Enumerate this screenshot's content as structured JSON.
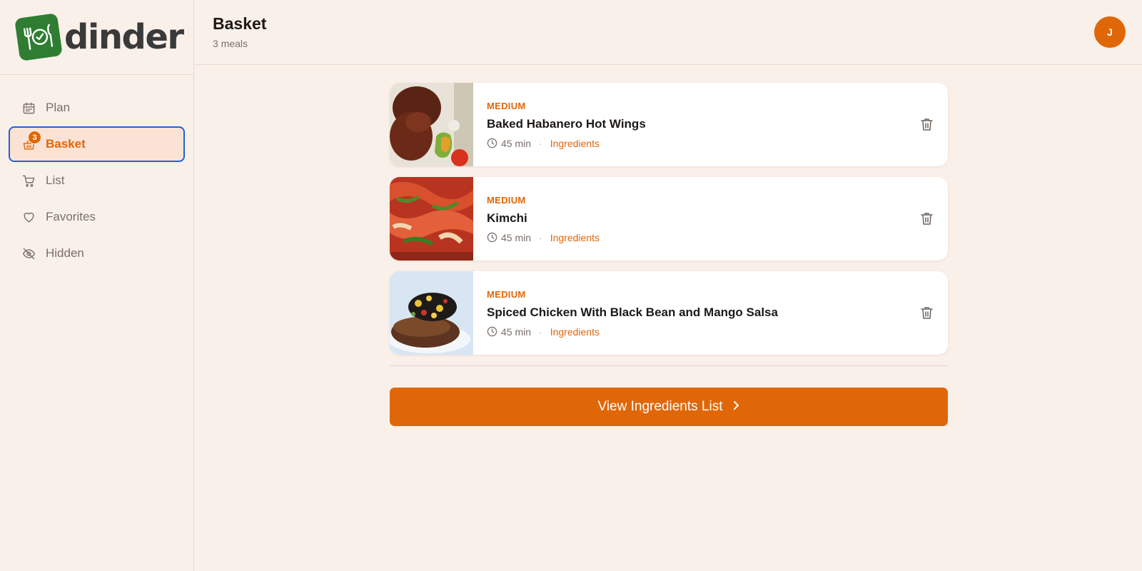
{
  "app": {
    "name": "dinder",
    "brand_color": "#2e7d32",
    "accent_color": "#e06708"
  },
  "sidebar": {
    "items": [
      {
        "label": "Plan",
        "icon": "calendar-icon"
      },
      {
        "label": "Basket",
        "icon": "basket-icon",
        "badge": "3",
        "active": true
      },
      {
        "label": "List",
        "icon": "cart-icon"
      },
      {
        "label": "Favorites",
        "icon": "heart-icon"
      },
      {
        "label": "Hidden",
        "icon": "eye-off-icon"
      }
    ]
  },
  "header": {
    "title": "Basket",
    "subtitle": "3 meals",
    "avatar_initial": "J"
  },
  "meals": [
    {
      "difficulty": "MEDIUM",
      "title": "Baked Habanero Hot Wings",
      "time": "45 min",
      "ingredients_label": "Ingredients"
    },
    {
      "difficulty": "MEDIUM",
      "title": "Kimchi",
      "time": "45 min",
      "ingredients_label": "Ingredients"
    },
    {
      "difficulty": "MEDIUM",
      "title": "Spiced Chicken With Black Bean and Mango Salsa",
      "time": "45 min",
      "ingredients_label": "Ingredients"
    }
  ],
  "cta": {
    "label": "View Ingredients List"
  }
}
